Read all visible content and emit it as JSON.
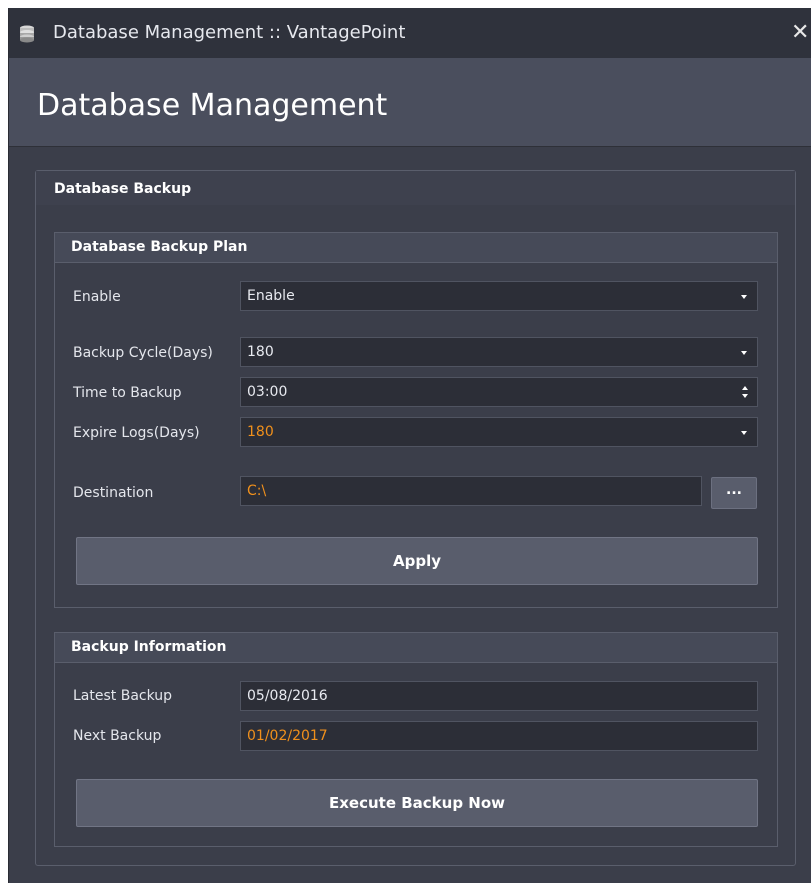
{
  "window": {
    "title": "Database Management :: VantagePoint",
    "icon": "database-icon",
    "close_label": "✕"
  },
  "header": {
    "title": "Database Management"
  },
  "backup_group": {
    "title": "Database Backup",
    "plan": {
      "title": "Database Backup Plan",
      "enable": {
        "label": "Enable",
        "value": "Enable"
      },
      "cycle": {
        "label": "Backup Cycle(Days)",
        "value": "180"
      },
      "time": {
        "label": "Time to Backup",
        "value": "03:00"
      },
      "expire": {
        "label": "Expire Logs(Days)",
        "value": "180"
      },
      "destination": {
        "label": "Destination",
        "value": "C:\\",
        "browse_label": "..."
      },
      "apply_label": "Apply"
    },
    "info": {
      "title": "Backup Information",
      "latest": {
        "label": "Latest Backup",
        "value": "05/08/2016"
      },
      "next": {
        "label": "Next Backup",
        "value": "01/02/2017"
      },
      "execute_label": "Execute Backup Now"
    }
  },
  "colors": {
    "background": "#3b3e4a",
    "header": "#4a4e5d",
    "field": "#2c2e37",
    "button": "#595d6c",
    "accent_orange": "#f0901c"
  }
}
